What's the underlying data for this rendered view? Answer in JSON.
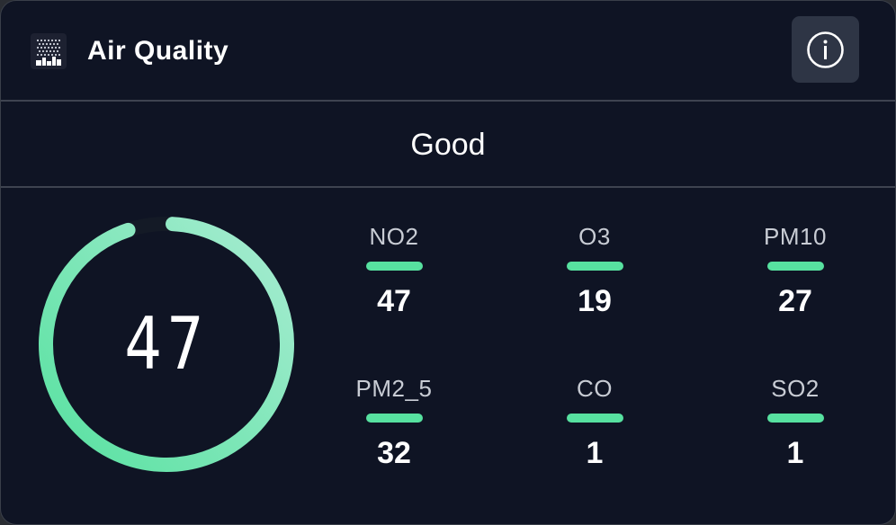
{
  "header": {
    "title": "Air Quality",
    "app_icon": "air-quality-app-icon",
    "info_icon": "info-icon"
  },
  "status": {
    "label": "Good"
  },
  "gauge": {
    "value": "47",
    "fraction": 0.94,
    "colors": {
      "start": "#57e1a0",
      "end": "#a8ecd2",
      "track": "#141a26"
    }
  },
  "metrics": [
    {
      "label": "NO2",
      "value": "47",
      "color": "#57e1a0"
    },
    {
      "label": "O3",
      "value": "19",
      "color": "#57e1a0"
    },
    {
      "label": "PM10",
      "value": "27",
      "color": "#57e1a0"
    },
    {
      "label": "PM2_5",
      "value": "32",
      "color": "#57e1a0"
    },
    {
      "label": "CO",
      "value": "1",
      "color": "#57e1a0"
    },
    {
      "label": "SO2",
      "value": "1",
      "color": "#57e1a0"
    }
  ],
  "colors": {
    "background": "#0f1424",
    "accent": "#57e1a0",
    "divider": "#3e4350",
    "info_button_bg": "#2e3545"
  }
}
